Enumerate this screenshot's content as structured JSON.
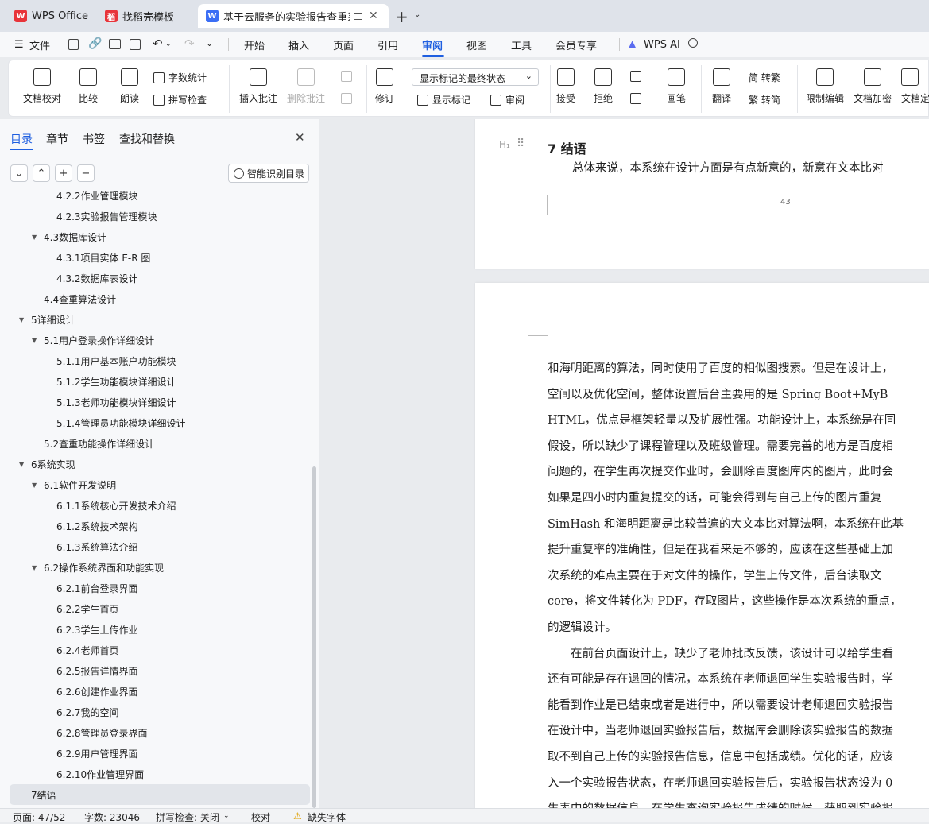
{
  "tabs": [
    {
      "label": "WPS Office",
      "icon": "wps-logo-icon",
      "color": "#e8343a"
    },
    {
      "label": "找稻壳模板",
      "icon": "docer-icon",
      "color": "#e8343a"
    },
    {
      "label": "基于云服务的实验报告查重系统",
      "icon": "writer-icon",
      "color": "#3b6ef5"
    }
  ],
  "menu": {
    "file": "文件",
    "items": [
      "开始",
      "插入",
      "页面",
      "引用",
      "审阅",
      "视图",
      "工具",
      "会员专享"
    ],
    "active": "审阅",
    "ai": "WPS AI"
  },
  "ribbon": {
    "doc_proofread": "文档校对",
    "compare": "比较",
    "read_aloud": "朗读",
    "word_count": "字数统计",
    "spell_check": "拼写检查",
    "insert_comment": "插入批注",
    "delete_comment": "删除批注",
    "track_changes": "修订",
    "markup_select": "显示标记的最终状态",
    "show_markup": "显示标记",
    "review": "审阅",
    "accept": "接受",
    "reject": "拒绝",
    "pen": "画笔",
    "translate": "翻译",
    "trad": "简 转繁",
    "simp": "繁 转简",
    "restrict": "限制编辑",
    "encrypt": "文档加密",
    "finalize": "文档定"
  },
  "sidebar": {
    "tabs": [
      "目录",
      "章节",
      "书签",
      "查找和替换"
    ],
    "smart": "智能识别目录",
    "items": [
      {
        "label": "4.2.2作业管理模块",
        "level": 3
      },
      {
        "label": "4.2.3实验报告管理模块",
        "level": 3
      },
      {
        "label": "4.3数据库设计",
        "level": 2,
        "expand": true
      },
      {
        "label": "4.3.1项目实体 E-R 图",
        "level": 3
      },
      {
        "label": "4.3.2数据库表设计",
        "level": 3
      },
      {
        "label": "4.4查重算法设计",
        "level": 2
      },
      {
        "label": "5详细设计",
        "level": 1,
        "expand": true
      },
      {
        "label": "5.1用户登录操作详细设计",
        "level": 2,
        "expand": true
      },
      {
        "label": "5.1.1用户基本账户功能模块",
        "level": 3
      },
      {
        "label": "5.1.2学生功能模块详细设计",
        "level": 3
      },
      {
        "label": "5.1.3老师功能模块详细设计",
        "level": 3
      },
      {
        "label": "5.1.4管理员功能模块详细设计",
        "level": 3
      },
      {
        "label": "5.2查重功能操作详细设计",
        "level": 2
      },
      {
        "label": "6系统实现",
        "level": 1,
        "expand": true
      },
      {
        "label": "6.1软件开发说明",
        "level": 2,
        "expand": true
      },
      {
        "label": "6.1.1系统核心开发技术介绍",
        "level": 3
      },
      {
        "label": "6.1.2系统技术架构",
        "level": 3
      },
      {
        "label": "6.1.3系统算法介绍",
        "level": 3
      },
      {
        "label": "6.2操作系统界面和功能实现",
        "level": 2,
        "expand": true
      },
      {
        "label": "6.2.1前台登录界面",
        "level": 3
      },
      {
        "label": "6.2.2学生首页",
        "level": 3
      },
      {
        "label": "6.2.3学生上传作业",
        "level": 3
      },
      {
        "label": "6.2.4老师首页",
        "level": 3
      },
      {
        "label": "6.2.5报告详情界面",
        "level": 3
      },
      {
        "label": "6.2.6创建作业界面",
        "level": 3
      },
      {
        "label": "6.2.7我的空间",
        "level": 3
      },
      {
        "label": "6.2.8管理员登录界面",
        "level": 3
      },
      {
        "label": "6.2.9用户管理界面",
        "level": 3
      },
      {
        "label": "6.2.10作业管理界面",
        "level": 3
      },
      {
        "label": "7结语",
        "level": 1,
        "selected": true
      }
    ]
  },
  "document": {
    "heading_marker": "H₁",
    "heading": "7 结语",
    "intro": "总体来说，本系统在设计方面是有点新意的，新意在文本比对",
    "page_number": "43",
    "lines": [
      "和海明距离的算法，同时使用了百度的相似图搜索。但是在设计上，",
      "空间以及优化空间，整体设置后台主要用的是 Spring Boot+MyB",
      "HTML，优点是框架轻量以及扩展性强。功能设计上，本系统是在同",
      "假设，所以缺少了课程管理以及班级管理。需要完善的地方是百度相",
      "问题的，在学生再次提交作业时，会删除百度图库内的图片，此时会",
      "如果是四小时内重复提交的话，可能会得到与自己上传的图片重复",
      "SimHash 和海明距离是比较普遍的大文本比对算法啊，本系统在此基",
      "提升重复率的准确性，但是在我看来是不够的，应该在这些基础上加",
      "次系统的难点主要在于对文件的操作，学生上传文件，后台读取文",
      "core，将文件转化为 PDF，存取图片，这些操作是本次系统的重点，",
      "的逻辑设计。",
      "　　在前台页面设计上，缺少了老师批改反馈，该设计可以给学生看",
      "还有可能是存在退回的情况，本系统在老师退回学生实验报告时，学",
      "能看到作业是已结束或者是进行中，所以需要设计老师退回实验报告",
      "在设计中，当老师退回实验报告后，数据库会删除该实验报告的数据",
      "取不到自己上传的实验报告信息，信息中包括成绩。优化的话，应该",
      "入一个实验报告状态，在老师退回实验报告后，实验报告状态设为 0",
      "生表中的数据信息，在学生查询实验报告成绩的时候，获取到实验报"
    ]
  },
  "status": {
    "page": "页面: 47/52",
    "words": "字数: 23046",
    "spell": "拼写检查: 关闭",
    "proof": "校对",
    "font": "缺失字体"
  }
}
